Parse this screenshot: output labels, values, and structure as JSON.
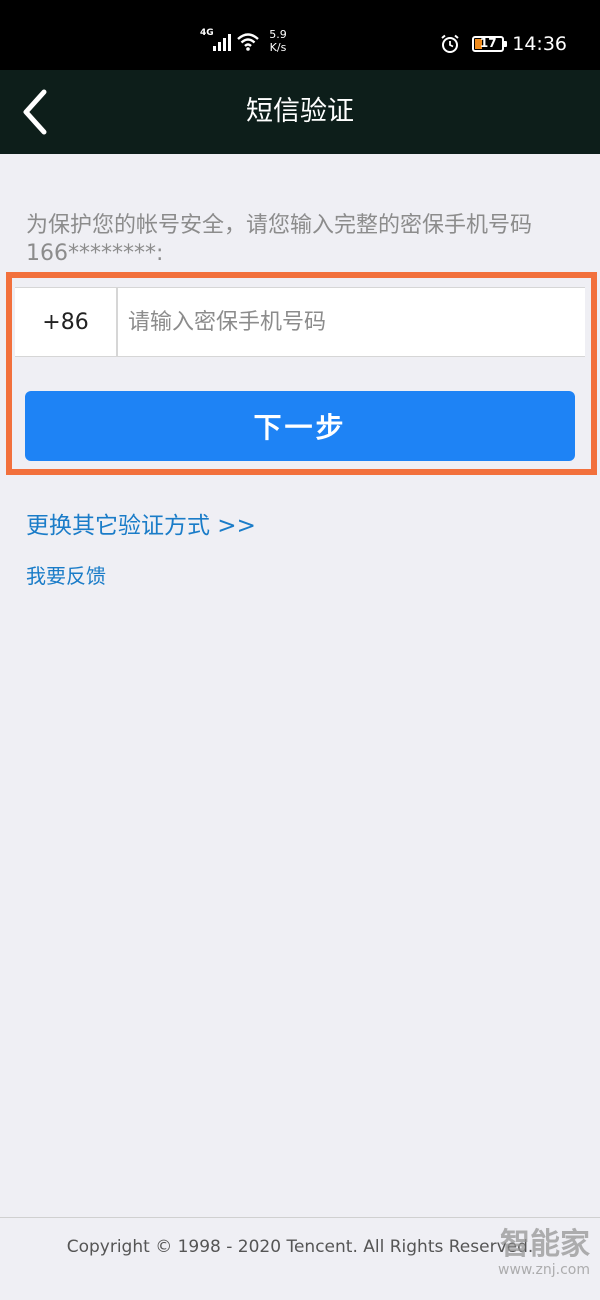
{
  "status_bar": {
    "network_type": "4G",
    "net_speed_value": "5.9",
    "net_speed_unit": "K/s",
    "battery_level": "17",
    "time": "14:36",
    "icons": [
      "signal-icon",
      "wifi-icon",
      "alarm-icon",
      "battery-icon"
    ]
  },
  "header": {
    "back_icon": "chevron-left-icon",
    "title": "短信验证"
  },
  "main": {
    "hint_text": "为保护您的帐号安全，请您输入完整的密保手机号码166********:",
    "country_code": "+86",
    "phone_input": {
      "value": "",
      "placeholder": "请输入密保手机号码"
    },
    "next_button_label": "下一步",
    "alt_verify_link": "更换其它验证方式 >>",
    "feedback_link": "我要反馈"
  },
  "footer": {
    "copyright": "Copyright © 1998 - 2020 Tencent. All Rights Reserved."
  },
  "watermark": {
    "text": "智能家",
    "url": "www.znj.com"
  },
  "colors": {
    "status_bar_bg": "#000000",
    "header_bg": "#0d1e1a",
    "page_bg": "#efeff4",
    "primary_button": "#1e83f5",
    "link": "#1a7cc8",
    "highlight_border": "#f2703c",
    "battery_fill": "#f08c1e"
  }
}
